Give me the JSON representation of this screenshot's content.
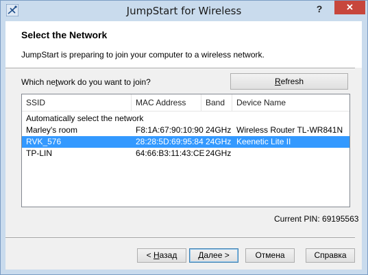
{
  "window": {
    "title": "JumpStart for Wireless",
    "help_label": "?",
    "close_label": "✕"
  },
  "header": {
    "heading": "Select the Network",
    "description": "JumpStart is preparing to join your computer to a wireless network."
  },
  "question": {
    "before": "Which ne",
    "accel": "t",
    "after": "work do you want to join?"
  },
  "refresh": {
    "accel": "R",
    "rest": "efresh"
  },
  "table": {
    "columns": [
      "SSID",
      "MAC Address",
      "Band",
      "Device Name"
    ],
    "auto_select_label": "Automatically select the network",
    "rows": [
      {
        "ssid": "Marley's room",
        "mac": "F8:1A:67:90:10:90",
        "band": "24GHz",
        "device": "Wireless Router TL-WR841N",
        "selected": false
      },
      {
        "ssid": "RVK_576",
        "mac": "28:28:5D:69:95:84",
        "band": "24GHz",
        "device": "Keenetic Lite II",
        "selected": true
      },
      {
        "ssid": "TP-LIN",
        "mac": "64:66:B3:11:43:CE",
        "band": "24GHz",
        "device": "",
        "selected": false
      }
    ]
  },
  "pin": {
    "label": "Current PIN: 69195563"
  },
  "footer": {
    "back": {
      "prefix": "< ",
      "accel": "Н",
      "rest": "азад"
    },
    "next": {
      "accel": "Д",
      "rest": "алее >"
    },
    "cancel": "Отмена",
    "help": "Справка"
  },
  "colors": {
    "selection": "#3399ff",
    "close_button": "#c7463c"
  }
}
